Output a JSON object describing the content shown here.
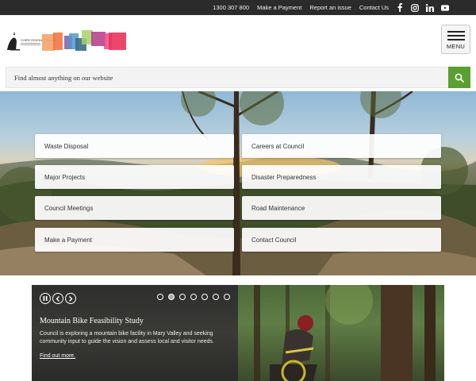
{
  "topbar": {
    "links": [
      "1300 307 800",
      "Make a Payment",
      "Report an issue",
      "Contact Us"
    ],
    "social_icons": [
      "facebook-icon",
      "instagram-icon",
      "linkedin-icon",
      "youtube-icon"
    ]
  },
  "header": {
    "logo_text": "GYMPIE REGIONAL COUNCIL",
    "menu_label": "MENU"
  },
  "search": {
    "placeholder": "Find almost anything on our website",
    "button_icon": "search-icon",
    "button_color": "#59a030"
  },
  "quick_links": [
    "Waste Disposal",
    "Careers at Council",
    "Major Projects",
    "Disaster Preparedness",
    "Council Meetings",
    "Road Maintenance",
    "Make a Payment",
    "Contact Council"
  ],
  "carousel": {
    "title": "Mountain Bike Feasibility Study",
    "text": "Council is exploring a mountain bike facility in Mary Valley and seeking community input to guide the vision and assess local and visitor needs.",
    "link": "Find out more.",
    "slide_count": 7,
    "active_slide": 2
  }
}
